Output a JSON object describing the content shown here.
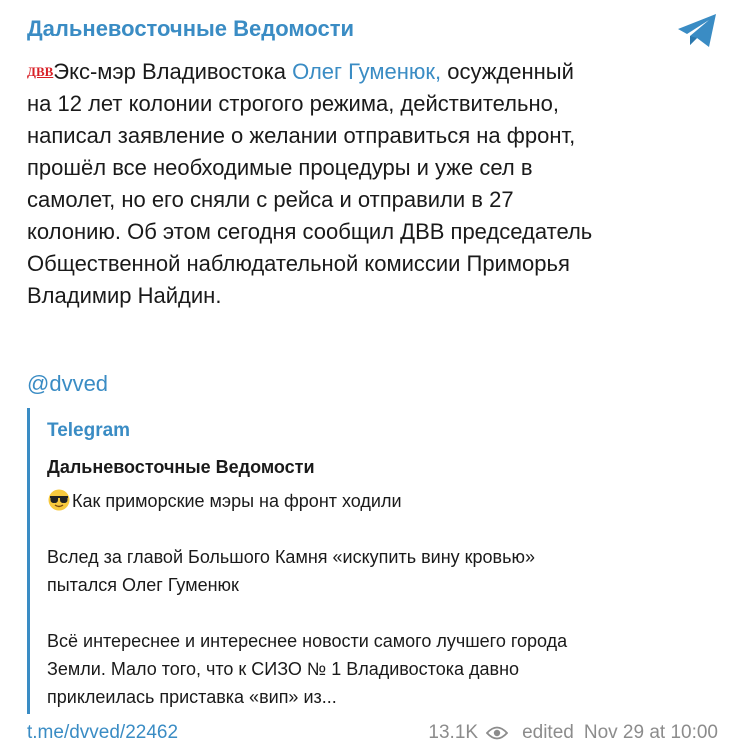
{
  "header": {
    "channel_title": "Дальневосточные Ведомости",
    "brand_color": "#3a8cc4",
    "telegram_icon": "telegram-plane-icon"
  },
  "post": {
    "logo_text": "ДВВ",
    "text_before_mention": "Экс-мэр Владивостока ",
    "mention": "Олег Гуменюк,",
    "line1_rest": " осужденный",
    "line2": "на 12 лет колонии строгого режима, действительно,",
    "line3": "написал заявление о желании отправиться на фронт,",
    "line4": "прошёл все необходимые процедуры и уже сел в",
    "line5": "самолет, но его сняли с рейса и отправили в 27",
    "line6": "колонию. Об этом сегодня сообщил ДВВ председатель",
    "line7": "Общественной наблюдательной комиссии Приморья",
    "line8": "Владимир Найдин.",
    "handle": "@dvved"
  },
  "preview": {
    "site_name": "Telegram",
    "title": "Дальневосточные Ведомости",
    "emoji": "sunglasses-emoji",
    "line1": "Как приморские мэры на фронт ходили",
    "line2": "Вслед за главой Большого Камня «искупить вину кровью»",
    "line3": "пытался Олег Гуменюк",
    "line4": "Всё интереснее и интереснее новости самого лучшего города",
    "line5": "Земли. Мало того, что к СИЗО № 1 Владивостока давно",
    "line6": "приклеилась приставка «вип» из..."
  },
  "footer": {
    "link": "t.me/dvved/22462",
    "views": "13.1K",
    "views_icon": "eye-icon",
    "edited": "edited",
    "date": "Nov 29 at 10:00"
  }
}
